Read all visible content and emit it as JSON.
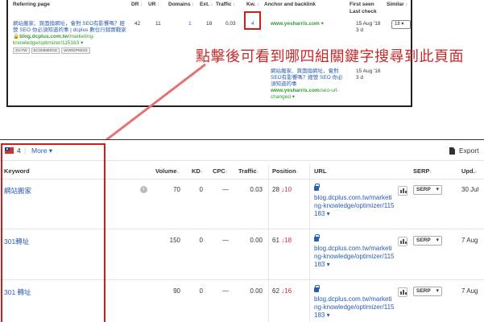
{
  "backlinks": {
    "headers": {
      "referring_page": "Referring page",
      "dr": "DR",
      "ur": "UR",
      "domains": "Domains",
      "ext": "Ext.",
      "traffic": "Traffic",
      "kw": "Kw.",
      "anchor": "Anchor and backlink",
      "first_seen": "First seen",
      "last_check": "Last check",
      "similar": "Similar"
    },
    "row1": {
      "title": "網站搬家、頁面換網址，會對 SEO有影響嗎？經營 SEO 你必須知道的事 | dcplus 數位行銷實戰家",
      "url_domain": "blog.dcplus.com.tw",
      "url_path": "/marketing-knowledge/optimizer/115183",
      "tags": [
        "ZH-TW",
        "ECOMMERCE",
        "WORDPRESS"
      ],
      "dr": "42",
      "ur": "11",
      "domains": "1",
      "ext": "18",
      "traffic": "0.03",
      "kw": "4",
      "anchor_domain": "www.yesharris.com",
      "first_seen": "15 Aug '18",
      "last_check": "3 d",
      "similar": "18"
    },
    "row2": {
      "anchor_title": "網站搬家、頁面換網址，會對 SEO有影響嗎？經營 SEO 你必須知道的事",
      "anchor_domain": "www.yesharris.com",
      "anchor_path": "/seo-url-changed",
      "first_seen": "15 Aug '18",
      "last_check": "3 d"
    }
  },
  "annotation": {
    "text": "點擊後可看到哪四組關鍵字搜尋到此頁面",
    "color": "#c62828"
  },
  "keywords": {
    "toolbar": {
      "count": "4",
      "more": "More",
      "export": "Export"
    },
    "headers": {
      "keyword": "Keyword",
      "volume": "Volume",
      "kd": "KD",
      "cpc": "CPC",
      "traffic": "Traffic",
      "position": "Position",
      "url": "URL",
      "serp": "SERP",
      "upd": "Upd."
    },
    "rows": [
      {
        "keyword": "網站搬家",
        "volume": "70",
        "kd": "0",
        "cpc": "—",
        "traffic": "0.03",
        "position": "28",
        "pos_change": "↓10",
        "url": "blog.dcplus.com.tw/marketing-knowledge/optimizer/115183",
        "serp": "SERP",
        "upd": "30 Jul"
      },
      {
        "keyword": "301轉址",
        "volume": "150",
        "kd": "0",
        "cpc": "—",
        "traffic": "0.00",
        "position": "61",
        "pos_change": "↓18",
        "url": "blog.dcplus.com.tw/marketing-knowledge/optimizer/115183",
        "serp": "SERP",
        "upd": "7 Aug"
      },
      {
        "keyword": "301 轉址",
        "volume": "90",
        "kd": "0",
        "cpc": "—",
        "traffic": "0.00",
        "position": "62",
        "pos_change": "↓16",
        "url": "blog.dcplus.com.tw/marketing-knowledge/optimizer/115183",
        "serp": "SERP",
        "upd": "7 Aug"
      }
    ]
  },
  "colors": {
    "link": "#2a5db0",
    "green": "#2f9c2f",
    "highlight": "#d21d1d"
  }
}
